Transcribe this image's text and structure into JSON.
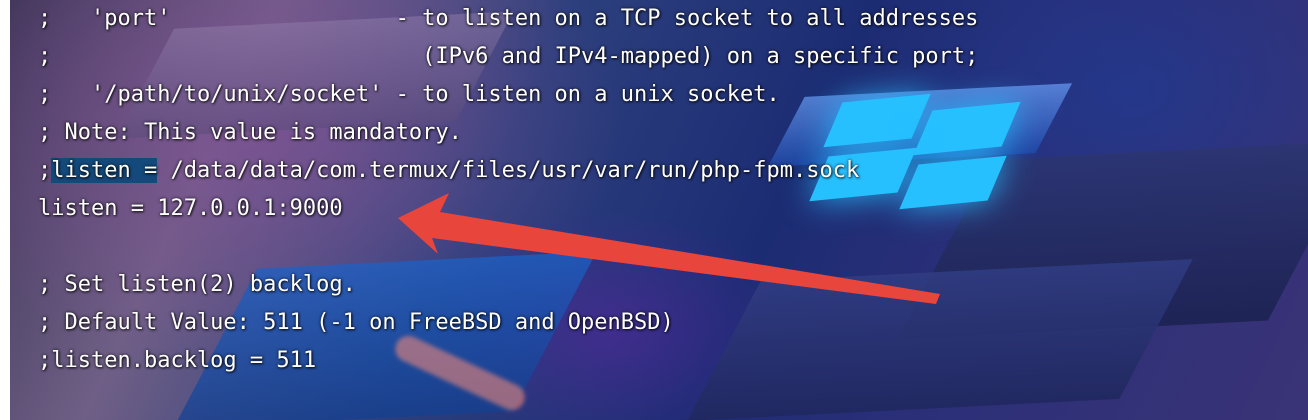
{
  "editor": {
    "lines": [
      {
        "text": ";   'port'                 - to listen on a TCP socket to all addresses"
      },
      {
        "text": ";                            (IPv6 and IPv4-mapped) on a specific port;"
      },
      {
        "text": ";   '/path/to/unix/socket' - to listen on a unix socket."
      },
      {
        "text": "; Note: This value is mandatory."
      },
      {
        "prefix": ";",
        "selected": "listen =",
        "rest": " /data/data/com.termux/files/usr/var/run/php-fpm.sock"
      },
      {
        "text": "listen = 127.0.0.1:9000"
      },
      {
        "text": ""
      },
      {
        "text": "; Set listen(2) backlog."
      },
      {
        "text": "; Default Value: 511 (-1 on FreeBSD and OpenBSD)"
      },
      {
        "text": ";listen.backlog = 511"
      }
    ]
  },
  "annotation": {
    "arrow_color": "#e8453c",
    "selection_color": "#144a7b",
    "icon": "arrow-annotation-icon"
  }
}
